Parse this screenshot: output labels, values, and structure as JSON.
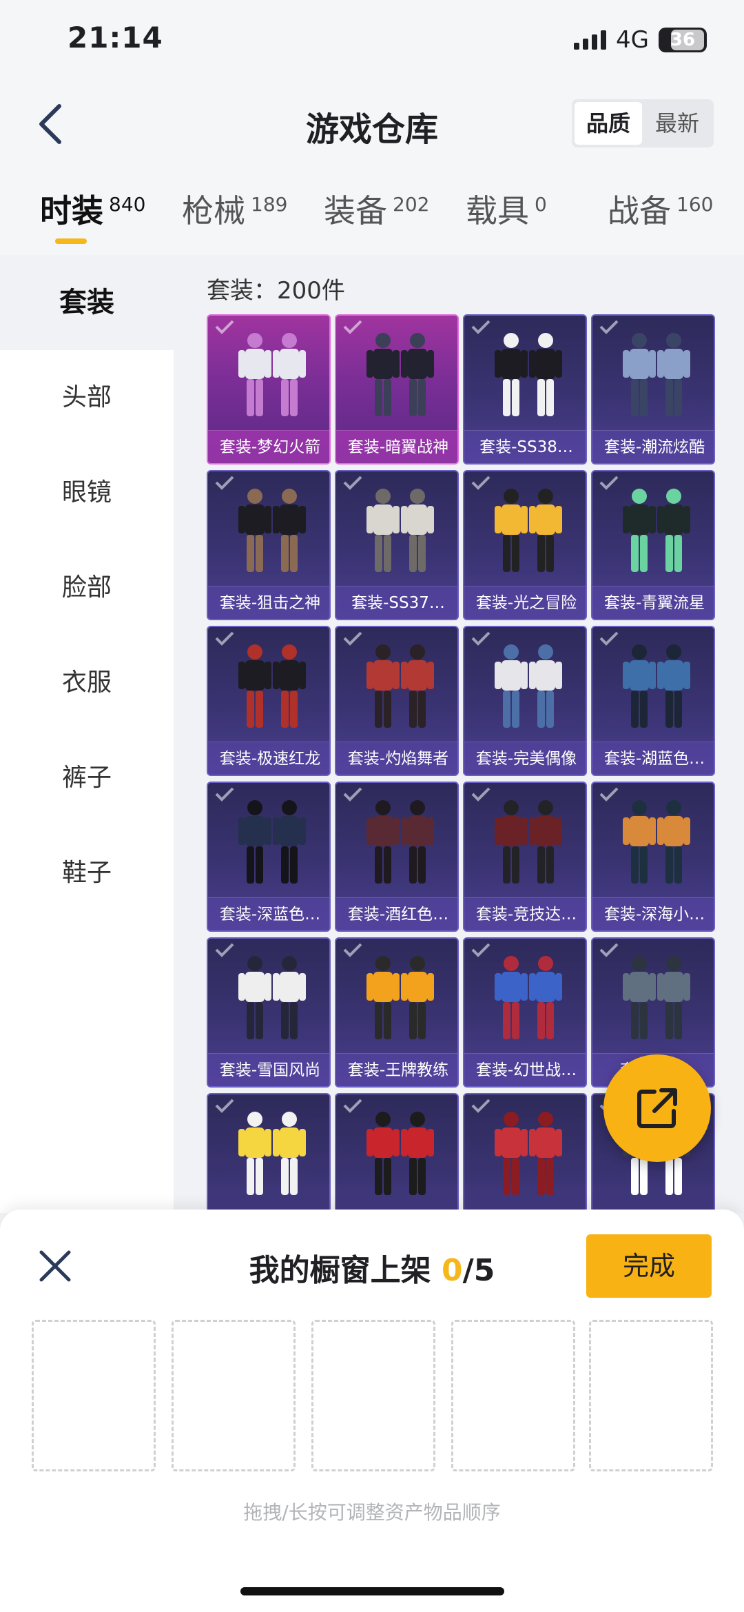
{
  "status_bar": {
    "time": "21:14",
    "network": "4G",
    "battery": "36"
  },
  "header": {
    "title": "游戏仓库",
    "sort_options": [
      "品质",
      "最新"
    ]
  },
  "tabs": [
    {
      "label": "时装",
      "count": "840"
    },
    {
      "label": "枪械",
      "count": "189"
    },
    {
      "label": "装备",
      "count": "202"
    },
    {
      "label": "载具",
      "count": "0"
    },
    {
      "label": "战备",
      "count": "160"
    }
  ],
  "sidebar": {
    "items": [
      "套装",
      "头部",
      "眼镜",
      "脸部",
      "衣服",
      "裤子",
      "鞋子"
    ]
  },
  "content": {
    "count_label": "套装：200件",
    "items": [
      {
        "name": "套装-梦幻火箭",
        "rarity": "legendary"
      },
      {
        "name": "套装-暗翼战神",
        "rarity": "legendary"
      },
      {
        "name": "套装-SS38…",
        "rarity": "epic"
      },
      {
        "name": "套装-潮流炫酷",
        "rarity": "epic"
      },
      {
        "name": "套装-狙击之神",
        "rarity": "epic"
      },
      {
        "name": "套装-SS37…",
        "rarity": "epic"
      },
      {
        "name": "套装-光之冒险",
        "rarity": "epic"
      },
      {
        "name": "套装-青翼流星",
        "rarity": "epic"
      },
      {
        "name": "套装-极速红龙",
        "rarity": "epic"
      },
      {
        "name": "套装-灼焰舞者",
        "rarity": "epic"
      },
      {
        "name": "套装-完美偶像",
        "rarity": "epic"
      },
      {
        "name": "套装-湖蓝色…",
        "rarity": "epic"
      },
      {
        "name": "套装-深蓝色…",
        "rarity": "epic"
      },
      {
        "name": "套装-酒红色…",
        "rarity": "epic"
      },
      {
        "name": "套装-竞技达…",
        "rarity": "epic"
      },
      {
        "name": "套装-深海小…",
        "rarity": "epic"
      },
      {
        "name": "套装-雪国风尚",
        "rarity": "epic"
      },
      {
        "name": "套装-王牌教练",
        "rarity": "epic"
      },
      {
        "name": "套装-幻世战…",
        "rarity": "epic"
      },
      {
        "name": "套装-…禽",
        "rarity": "epic"
      },
      {
        "name": "",
        "rarity": "epic"
      },
      {
        "name": "",
        "rarity": "epic"
      },
      {
        "name": "",
        "rarity": "epic"
      },
      {
        "name": "",
        "rarity": "epic"
      }
    ]
  },
  "showcase": {
    "title": "我的橱窗上架",
    "used": "0",
    "total": "/5",
    "done_label": "完成",
    "hint": "拖拽/长按可调整资产物品顺序"
  },
  "colors": {
    "accent": "#f8b213",
    "legendary": "#a0349f",
    "epic": "#3a3372"
  },
  "icons": [
    "back-icon",
    "signal-icon",
    "battery-icon",
    "check-icon",
    "share-icon",
    "close-icon"
  ]
}
